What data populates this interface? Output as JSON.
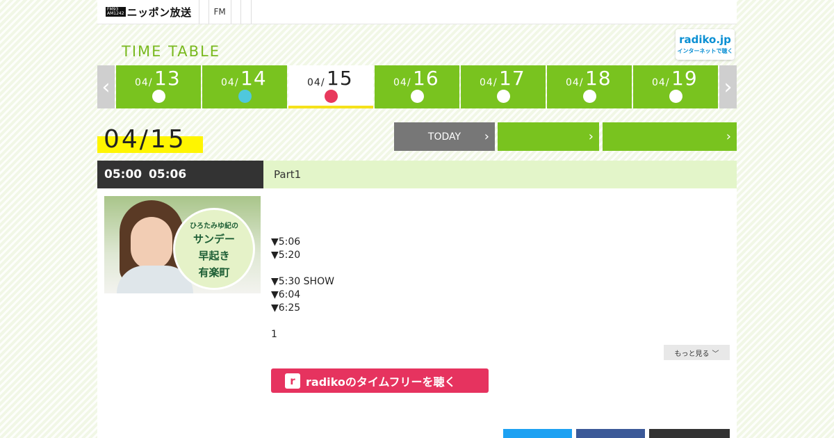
{
  "header": {
    "logo_band_top": "FM93",
    "logo_band_bottom": "AM1242",
    "logo_name": "ニッポン放送",
    "nav": [
      "FM",
      "",
      ""
    ]
  },
  "timetable_title": "TIME TABLE",
  "radiko_badge": {
    "name": "radiko.jp",
    "tagline": "インターネットで聴く"
  },
  "dates": [
    {
      "month": "04/",
      "day": "13",
      "dot": "#ffffff"
    },
    {
      "month": "04/",
      "day": "14",
      "dot": "#4fc8dd"
    },
    {
      "month": "04/",
      "day": "15",
      "dot": "#e8395c",
      "active": true
    },
    {
      "month": "04/",
      "day": "16",
      "dot": "#ffffff"
    },
    {
      "month": "04/",
      "day": "17",
      "dot": "#ffffff"
    },
    {
      "month": "04/",
      "day": "18",
      "dot": "#ffffff"
    },
    {
      "month": "04/",
      "day": "19",
      "dot": "#ffffff"
    }
  ],
  "selected_date": "04/15",
  "buttons": {
    "today": "TODAY",
    "green1": "",
    "green2": ""
  },
  "program": {
    "time": "05:00  05:06",
    "title": "Part1",
    "thumb_line1": "ひろたみゆ紀の",
    "thumb_line2": "サンデー",
    "thumb_line3": "早起き",
    "thumb_line4": "有楽町",
    "lines": [
      "▼5:06",
      "▼5:20",
      "",
      "▼5:30 SHOW",
      "▼6:04",
      "▼6:25",
      "",
      "1"
    ],
    "more_label": "もっと見る",
    "radiko_label": "radikoのタイムフリーを聴く",
    "radiko_mark": "r"
  },
  "share": [
    "",
    "",
    ""
  ],
  "colors": {
    "green": "#79c31f",
    "accent_yellow": "#fff500",
    "radiko_pink": "#e6335f",
    "dark": "#333333"
  }
}
